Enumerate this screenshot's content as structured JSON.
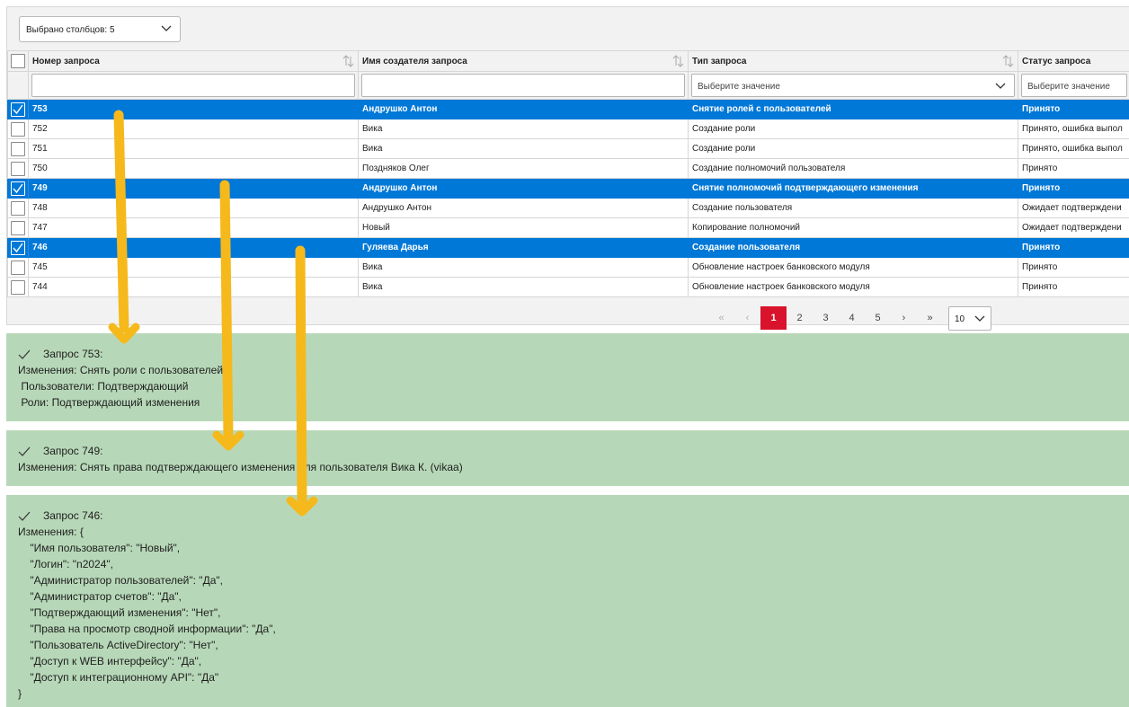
{
  "columns_select": {
    "label": "Выбрано столбцов: 5"
  },
  "columns": [
    {
      "title": "Номер запроса"
    },
    {
      "title": "Имя создателя запроса"
    },
    {
      "title": "Тип запроса"
    },
    {
      "title": "Статус запроса"
    }
  ],
  "filters": {
    "type_placeholder": "Выберите значение",
    "status_placeholder": "Выберите значение"
  },
  "rows": [
    {
      "id": "753",
      "creator": "Андрушко Антон",
      "type": "Снятие ролей с пользователей",
      "status": "Принято",
      "selected": true
    },
    {
      "id": "752",
      "creator": "Вика",
      "type": "Создание роли",
      "status": "Принято, ошибка выпол",
      "selected": false
    },
    {
      "id": "751",
      "creator": "Вика",
      "type": "Создание роли",
      "status": "Принято, ошибка выпол",
      "selected": false
    },
    {
      "id": "750",
      "creator": "Поздняков Олег",
      "type": "Создание полномочий пользователя",
      "status": "Принято",
      "selected": false
    },
    {
      "id": "749",
      "creator": "Андрушко Антон",
      "type": "Снятие полномочий подтверждающего изменения",
      "status": "Принято",
      "selected": true
    },
    {
      "id": "748",
      "creator": "Андрушко Антон",
      "type": "Создание пользователя",
      "status": "Ожидает подтверждени",
      "selected": false
    },
    {
      "id": "747",
      "creator": "Новый",
      "type": "Копирование полномочий",
      "status": "Ожидает подтверждени",
      "selected": false
    },
    {
      "id": "746",
      "creator": "Гуляева Дарья",
      "type": "Создание пользователя",
      "status": "Принято",
      "selected": true
    },
    {
      "id": "745",
      "creator": "Вика",
      "type": "Обновление настроек банковского модуля",
      "status": "Принято",
      "selected": false
    },
    {
      "id": "744",
      "creator": "Вика",
      "type": "Обновление настроек банковского модуля",
      "status": "Принято",
      "selected": false
    }
  ],
  "pagination": {
    "first": "«",
    "prev": "‹",
    "pages": [
      "1",
      "2",
      "3",
      "4",
      "5"
    ],
    "current": "1",
    "next": "›",
    "last": "»",
    "page_size": "10"
  },
  "details": [
    {
      "title": "Запрос 753:",
      "lines": [
        "Изменения: Снять роли с пользователей",
        " Пользователи: Подтверждающий",
        " Роли: Подтверждающий изменения"
      ]
    },
    {
      "title": "Запрос 749:",
      "lines": [
        "Изменения: Снять права подтверждающего изменения для пользователя Вика К. (vikaa)"
      ]
    },
    {
      "title": "Запрос 746:",
      "lines": [
        "Изменения: {",
        "    \"Имя пользователя\": \"Новый\",",
        "    \"Логин\": \"n2024\",",
        "    \"Администратор пользователей\": \"Да\",",
        "    \"Администратор счетов\": \"Да\",",
        "    \"Подтверждающий изменения\": \"Нет\",",
        "    \"Права на просмотр сводной информации\": \"Да\",",
        "    \"Пользователь ActiveDirectory\": \"Нет\",",
        "    \"Доступ к WEB интерфейсу\": \"Да\",",
        "    \"Доступ к интеграционному API\": \"Да\"",
        "}"
      ]
    }
  ],
  "colors": {
    "selected_row": "#0078d7",
    "active_page": "#d9132b",
    "detail_panel": "#b7d8b8",
    "arrow": "#f5b91c"
  },
  "icons": [
    "chevron-down-icon",
    "sort-icon",
    "checkmark-icon"
  ]
}
